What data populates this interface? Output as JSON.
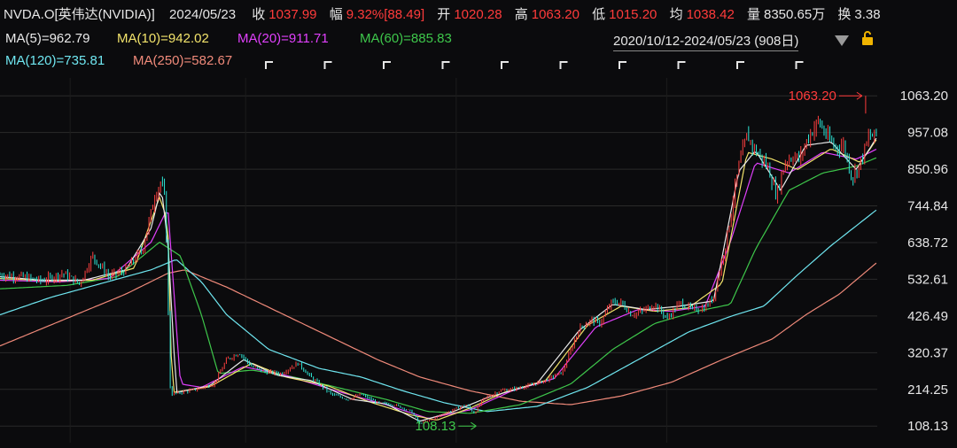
{
  "header": {
    "symbol": "NVDA.O[英伟达(NVIDIA)]",
    "date": "2024/05/23",
    "close_label": "收",
    "close_value": "1037.99",
    "change_label": "幅",
    "change_value": "9.32%[88.49]",
    "open_label": "开",
    "open_value": "1020.28",
    "high_label": "高",
    "high_value": "1063.20",
    "low_label": "低",
    "low_value": "1015.20",
    "avg_label": "均",
    "avg_value": "1038.42",
    "volume_label": "量",
    "volume_value": "8350.65万",
    "turnover_label": "换",
    "turnover_value": "3.38"
  },
  "ma_legend": [
    {
      "text": "MA(5)=962.79",
      "color": "#e9e9e9"
    },
    {
      "text": "MA(10)=942.02",
      "color": "#f2e36b"
    },
    {
      "text": "MA(20)=911.71",
      "color": "#e040fb"
    },
    {
      "text": "MA(60)=885.83",
      "color": "#3ec74b"
    },
    {
      "text": "MA(120)=735.81",
      "color": "#6fe6f0"
    },
    {
      "text": "MA(250)=582.67",
      "color": "#f08a7a"
    }
  ],
  "range_label": "2020/10/12-2024/05/23 (908日)",
  "icons": {
    "dropdown": "triangle-down-icon",
    "lock": "lock-icon"
  },
  "chart_data": {
    "type": "line",
    "y_ticks": [
      "1063.20",
      "957.08",
      "850.96",
      "744.84",
      "638.72",
      "532.61",
      "426.49",
      "320.37",
      "214.25",
      "108.13"
    ],
    "ylim": [
      60,
      1115
    ],
    "x_count": 908,
    "high_annotation": {
      "index": 895,
      "value": 1063.2,
      "text": "1063.20"
    },
    "low_annotation": {
      "index": 496,
      "value": 108.13,
      "text": "108.13"
    },
    "colors": {
      "up": "#ff4040",
      "down": "#2ee6d6",
      "price": "#ff5a5a",
      "grid": "#2a2a2a",
      "axis_text": "#e6e6e6",
      "high": "#ff3b3b",
      "low": "#3ec74b"
    },
    "price_keypoints": [
      [
        0,
        545
      ],
      [
        25,
        540
      ],
      [
        50,
        528
      ],
      [
        75,
        550
      ],
      [
        95,
        520
      ],
      [
        110,
        600
      ],
      [
        130,
        540
      ],
      [
        150,
        560
      ],
      [
        170,
        620
      ],
      [
        185,
        780
      ],
      [
        192,
        815
      ],
      [
        197,
        760
      ],
      [
        203,
        200
      ],
      [
        215,
        205
      ],
      [
        235,
        215
      ],
      [
        255,
        230
      ],
      [
        270,
        300
      ],
      [
        285,
        320
      ],
      [
        300,
        280
      ],
      [
        315,
        265
      ],
      [
        335,
        260
      ],
      [
        355,
        290
      ],
      [
        370,
        250
      ],
      [
        380,
        230
      ],
      [
        395,
        200
      ],
      [
        415,
        185
      ],
      [
        430,
        200
      ],
      [
        450,
        175
      ],
      [
        470,
        170
      ],
      [
        490,
        150
      ],
      [
        500,
        115
      ],
      [
        515,
        128
      ],
      [
        530,
        145
      ],
      [
        540,
        155
      ],
      [
        555,
        170
      ],
      [
        565,
        145
      ],
      [
        575,
        185
      ],
      [
        595,
        210
      ],
      [
        610,
        215
      ],
      [
        630,
        225
      ],
      [
        650,
        240
      ],
      [
        670,
        265
      ],
      [
        690,
        390
      ],
      [
        705,
        415
      ],
      [
        715,
        405
      ],
      [
        728,
        465
      ],
      [
        740,
        465
      ],
      [
        752,
        430
      ],
      [
        765,
        440
      ],
      [
        780,
        460
      ],
      [
        795,
        420
      ],
      [
        810,
        465
      ],
      [
        825,
        445
      ],
      [
        840,
        450
      ],
      [
        850,
        480
      ],
      [
        865,
        640
      ],
      [
        880,
        860
      ],
      [
        890,
        950
      ],
      [
        898,
        910
      ],
      [
        905,
        890
      ],
      [
        915,
        855
      ],
      [
        925,
        775
      ],
      [
        935,
        870
      ],
      [
        945,
        890
      ],
      [
        953,
        880
      ],
      [
        962,
        940
      ],
      [
        975,
        990
      ],
      [
        985,
        945
      ],
      [
        995,
        915
      ],
      [
        1005,
        920
      ],
      [
        1015,
        825
      ],
      [
        1025,
        870
      ],
      [
        1035,
        945
      ],
      [
        1045,
        950
      ]
    ],
    "ma_keypoints": {
      "MA(5)": [
        [
          0,
          540
        ],
        [
          50,
          530
        ],
        [
          100,
          530
        ],
        [
          150,
          560
        ],
        [
          180,
          680
        ],
        [
          192,
          800
        ],
        [
          200,
          640
        ],
        [
          210,
          205
        ],
        [
          250,
          225
        ],
        [
          290,
          300
        ],
        [
          330,
          255
        ],
        [
          370,
          240
        ],
        [
          420,
          185
        ],
        [
          460,
          172
        ],
        [
          500,
          122
        ],
        [
          540,
          150
        ],
        [
          580,
          190
        ],
        [
          640,
          232
        ],
        [
          690,
          385
        ],
        [
          730,
          460
        ],
        [
          770,
          445
        ],
        [
          810,
          455
        ],
        [
          850,
          470
        ],
        [
          880,
          845
        ],
        [
          900,
          905
        ],
        [
          930,
          790
        ],
        [
          960,
          920
        ],
        [
          990,
          930
        ],
        [
          1020,
          850
        ],
        [
          1045,
          945
        ]
      ],
      "MA(10)": [
        [
          0,
          535
        ],
        [
          60,
          528
        ],
        [
          110,
          530
        ],
        [
          160,
          565
        ],
        [
          190,
          770
        ],
        [
          200,
          700
        ],
        [
          205,
          205
        ],
        [
          250,
          222
        ],
        [
          300,
          290
        ],
        [
          340,
          250
        ],
        [
          390,
          225
        ],
        [
          440,
          178
        ],
        [
          490,
          140
        ],
        [
          520,
          125
        ],
        [
          560,
          160
        ],
        [
          600,
          205
        ],
        [
          650,
          240
        ],
        [
          700,
          400
        ],
        [
          740,
          455
        ],
        [
          780,
          440
        ],
        [
          820,
          450
        ],
        [
          860,
          520
        ],
        [
          890,
          900
        ],
        [
          920,
          880
        ],
        [
          950,
          850
        ],
        [
          990,
          910
        ],
        [
          1025,
          870
        ],
        [
          1045,
          940
        ]
      ],
      "MA(20)": [
        [
          0,
          530
        ],
        [
          70,
          525
        ],
        [
          130,
          535
        ],
        [
          180,
          640
        ],
        [
          200,
          740
        ],
        [
          215,
          230
        ],
        [
          240,
          220
        ],
        [
          290,
          280
        ],
        [
          340,
          255
        ],
        [
          400,
          210
        ],
        [
          460,
          170
        ],
        [
          510,
          130
        ],
        [
          560,
          155
        ],
        [
          610,
          210
        ],
        [
          660,
          245
        ],
        [
          710,
          395
        ],
        [
          760,
          445
        ],
        [
          800,
          440
        ],
        [
          840,
          455
        ],
        [
          870,
          640
        ],
        [
          900,
          870
        ],
        [
          940,
          840
        ],
        [
          980,
          900
        ],
        [
          1020,
          880
        ],
        [
          1045,
          910
        ]
      ],
      "MA(60)": [
        [
          0,
          505
        ],
        [
          80,
          515
        ],
        [
          140,
          540
        ],
        [
          190,
          640
        ],
        [
          215,
          600
        ],
        [
          240,
          430
        ],
        [
          260,
          260
        ],
        [
          300,
          270
        ],
        [
          350,
          250
        ],
        [
          410,
          215
        ],
        [
          460,
          185
        ],
        [
          510,
          150
        ],
        [
          560,
          145
        ],
        [
          620,
          170
        ],
        [
          680,
          230
        ],
        [
          730,
          330
        ],
        [
          780,
          405
        ],
        [
          830,
          440
        ],
        [
          870,
          460
        ],
        [
          900,
          620
        ],
        [
          940,
          790
        ],
        [
          980,
          840
        ],
        [
          1020,
          860
        ],
        [
          1045,
          885
        ]
      ],
      "MA(120)": [
        [
          0,
          430
        ],
        [
          60,
          480
        ],
        [
          120,
          520
        ],
        [
          180,
          560
        ],
        [
          210,
          590
        ],
        [
          240,
          525
        ],
        [
          270,
          430
        ],
        [
          320,
          330
        ],
        [
          380,
          275
        ],
        [
          430,
          250
        ],
        [
          480,
          210
        ],
        [
          530,
          175
        ],
        [
          580,
          150
        ],
        [
          640,
          165
        ],
        [
          700,
          220
        ],
        [
          760,
          300
        ],
        [
          820,
          380
        ],
        [
          870,
          425
        ],
        [
          910,
          455
        ],
        [
          950,
          545
        ],
        [
          990,
          630
        ],
        [
          1045,
          735
        ]
      ],
      "MA(250)": [
        [
          0,
          340
        ],
        [
          80,
          420
        ],
        [
          150,
          490
        ],
        [
          200,
          550
        ],
        [
          220,
          560
        ],
        [
          270,
          510
        ],
        [
          330,
          440
        ],
        [
          390,
          370
        ],
        [
          450,
          300
        ],
        [
          500,
          250
        ],
        [
          560,
          210
        ],
        [
          620,
          180
        ],
        [
          680,
          170
        ],
        [
          740,
          195
        ],
        [
          800,
          235
        ],
        [
          860,
          300
        ],
        [
          920,
          360
        ],
        [
          960,
          430
        ],
        [
          1000,
          490
        ],
        [
          1045,
          582
        ]
      ]
    }
  }
}
